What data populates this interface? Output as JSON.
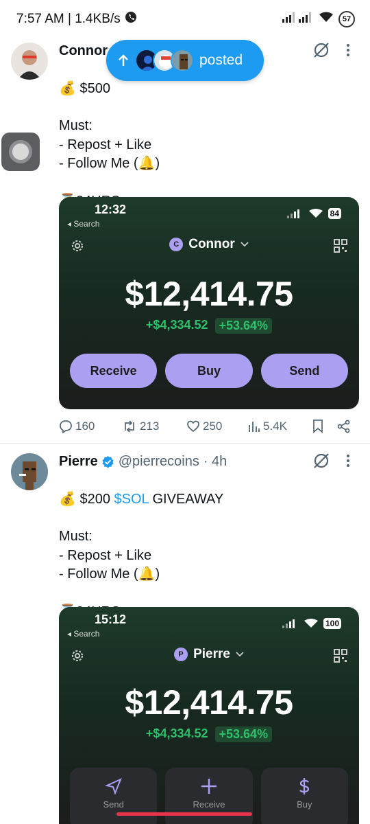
{
  "status_bar": {
    "time_speed": "7:57 AM | 1.4KB/s",
    "battery": "57"
  },
  "posted_pill": {
    "label": "posted"
  },
  "tweets": [
    {
      "author": "Connor",
      "text_line1": "$500",
      "body": "Must:\n- Repost + Like\n- Follow Me (🔔)\n\n⏳24HRS",
      "media": {
        "time": "12:32",
        "back": "◂ Search",
        "battery": "84",
        "account_initial": "C",
        "account_name": "Connor",
        "balance": "$12,414.75",
        "change": "+$4,334.52",
        "change_pct": "+53.64%",
        "buttons": [
          "Receive",
          "Buy",
          "Send"
        ]
      },
      "stats": {
        "replies": "160",
        "reposts": "213",
        "likes": "250",
        "views": "5.4K"
      }
    },
    {
      "author": "Pierre",
      "handle": "@pierrecoins",
      "age": "· 4h",
      "text_amount": "$200 ",
      "text_cashtag": "$SOL",
      "text_rest": " GIVEAWAY",
      "body": "Must:\n- Repost + Like\n- Follow Me (🔔)\n\n⏳24HRS",
      "media": {
        "time": "15:12",
        "back": "◂ Search",
        "battery": "100",
        "account_initial": "P",
        "account_name": "Pierre",
        "balance": "$12,414.75",
        "change": "+$4,334.52",
        "change_pct": "+53.64%",
        "tiles": [
          "Send",
          "Receive",
          "Buy"
        ]
      }
    }
  ],
  "colors": {
    "accent": "#1d9bf0",
    "wallet_purple": "#ab9ff2",
    "gain_green": "#2ec06b"
  },
  "icons": [
    "phone-icon",
    "signal-icon",
    "wifi-icon",
    "battery-icon",
    "grok-icon",
    "more-icon",
    "reply-icon",
    "repost-icon",
    "like-icon",
    "views-icon",
    "bookmark-icon",
    "share-icon",
    "verified-icon",
    "gear-icon",
    "qr-icon",
    "send-icon",
    "plus-icon",
    "dollar-icon"
  ]
}
